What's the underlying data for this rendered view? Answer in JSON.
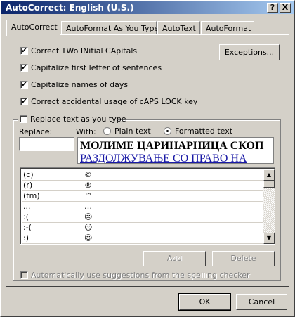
{
  "window": {
    "title": "AutoCorrect: English (U.S.)",
    "help_label": "?",
    "close_label": "X"
  },
  "tabs": [
    {
      "label": "AutoCorrect"
    },
    {
      "label": "AutoFormat As You Type"
    },
    {
      "label": "AutoText"
    },
    {
      "label": "AutoFormat"
    }
  ],
  "options": [
    {
      "label": "Correct TWo INitial CApitals",
      "checked": true
    },
    {
      "label": "Capitalize first letter of sentences",
      "checked": true
    },
    {
      "label": "Capitalize names of days",
      "checked": true
    },
    {
      "label": "Correct accidental usage of cAPS LOCK key",
      "checked": true
    }
  ],
  "exceptions_label": "Exceptions...",
  "replace_group": {
    "checkbox_label": "Replace text as you type",
    "checked": false,
    "replace_label": "Replace:",
    "with_label": "With:",
    "plain_text_label": "Plain text",
    "formatted_text_label": "Formatted text",
    "selected_format": "Formatted text",
    "replace_value": "",
    "preview_line1": "МОЛИМЕ ЦАРИНАРНИЦА СКОП",
    "preview_line2": "РАЗДОЛЖУВАЊЕ СО ПРАВО НА"
  },
  "entries": [
    {
      "replace": "(c)",
      "with": "©"
    },
    {
      "replace": "(r)",
      "with": "®"
    },
    {
      "replace": "(tm)",
      "with": "™"
    },
    {
      "replace": "...",
      "with": "…"
    },
    {
      "replace": ":(",
      "with": "☹"
    },
    {
      "replace": ":-(",
      "with": "☹"
    },
    {
      "replace": ":)",
      "with": "☺"
    }
  ],
  "add_label": "Add",
  "delete_label": "Delete",
  "suggestions_label": "Automatically use suggestions from the spelling checker",
  "ok_label": "OK",
  "cancel_label": "Cancel",
  "colors": {
    "title_bar_start": "#0a246a",
    "title_bar_end": "#a6caf0",
    "face": "#d4d0c8",
    "link_blue": "#1a1aa6"
  }
}
